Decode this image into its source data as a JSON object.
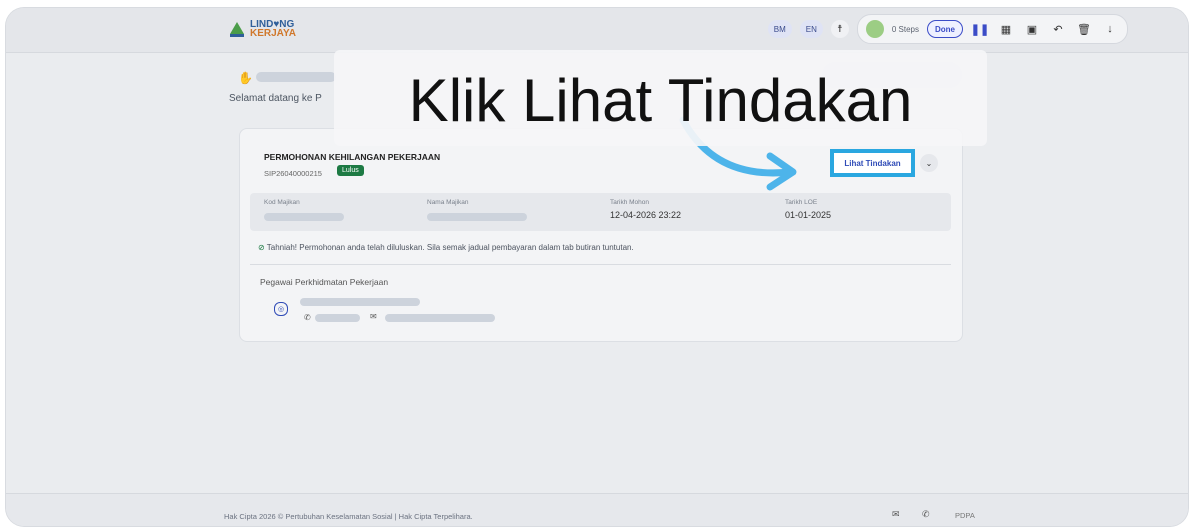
{
  "brand": {
    "line1": "LIND♥NG",
    "line2": "KERJAYA"
  },
  "toolbar": {
    "lang_bm": "BM",
    "lang_en": "EN",
    "accessibility": "☨",
    "steps": "0 Steps",
    "done": "Done"
  },
  "welcome": "Selamat datang ke P",
  "overlay": "Klik Lihat Tindakan",
  "card": {
    "title": "PERMOHONAN KEHILANGAN PEKERJAAN",
    "id": "SIP26040000215",
    "status": "Lulus",
    "action_label": "Lihat Tindakan",
    "fields": [
      {
        "label": "Kod Majikan",
        "value": ""
      },
      {
        "label": "Nama Majikan",
        "value": ""
      },
      {
        "label": "Tarikh Mohon",
        "value": "12-04-2026 23:22"
      },
      {
        "label": "Tarikh LOE",
        "value": "01-01-2025"
      }
    ],
    "success_msg": "Tahniah! Permohonan anda telah diluluskan. Sila semak jadual pembayaran dalam tab butiran tuntutan.",
    "pegawai_label": "Pegawai Perkhidmatan Pekerjaan"
  },
  "footer": {
    "copyright": "Hak Cipta 2026 © Pertubuhan Keselamatan Sosial | Hak Cipta Terpelihara.",
    "pdpa": "PDPA"
  },
  "colors": {
    "highlight": "#2aa7e0",
    "status_green": "#1d7a44",
    "brand_blue": "#2f4bb7"
  }
}
